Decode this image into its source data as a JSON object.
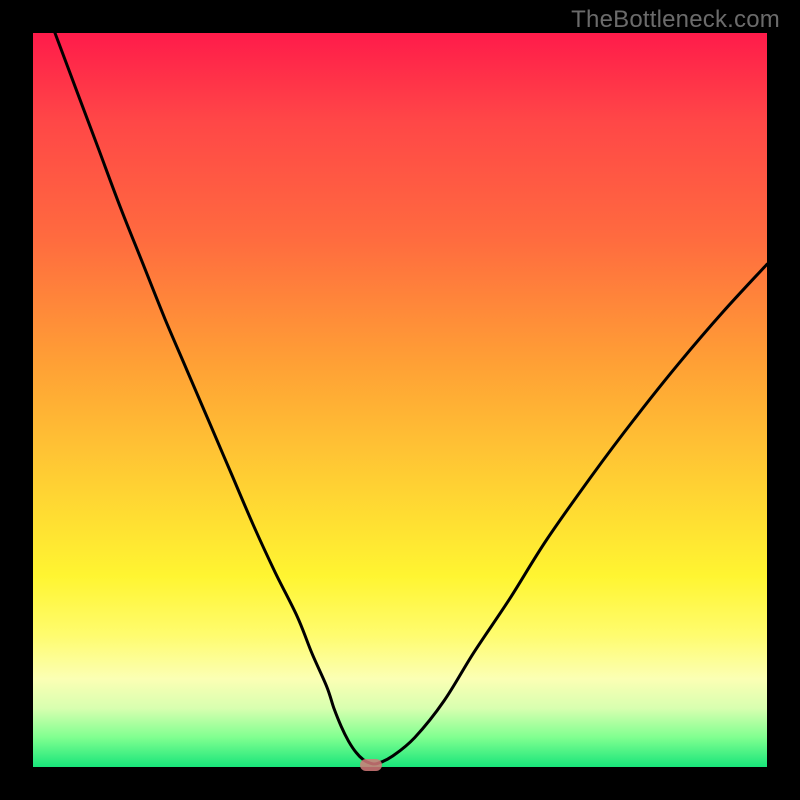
{
  "watermark": "TheBottleneck.com",
  "colors": {
    "frame": "#000000",
    "curve": "#000000",
    "marker": "#d47a7a",
    "gradient_stops": [
      "#ff1b4a",
      "#ff4747",
      "#ff6b3f",
      "#ffa035",
      "#ffd233",
      "#fff531",
      "#fffc6e",
      "#fbffb4",
      "#d8ffb0",
      "#7fff90",
      "#18e57a"
    ]
  },
  "chart_data": {
    "type": "line",
    "title": "",
    "xlabel": "",
    "ylabel": "",
    "xlim": [
      0,
      100
    ],
    "ylim": [
      0,
      100
    ],
    "grid": false,
    "legend": false,
    "x": [
      3,
      6,
      9,
      12,
      15,
      18,
      21,
      24,
      27,
      30,
      33,
      36,
      38,
      40,
      41,
      42,
      43,
      44,
      45,
      46,
      47,
      49,
      52,
      56,
      60,
      65,
      70,
      76,
      82,
      88,
      94,
      100
    ],
    "values": [
      100,
      92,
      84,
      76,
      68.5,
      61,
      54,
      47,
      40,
      33,
      26.5,
      20.5,
      15.5,
      11,
      8,
      5.5,
      3.5,
      2,
      1,
      0.5,
      0.5,
      1.5,
      4,
      9,
      15.5,
      23,
      31,
      39.5,
      47.5,
      55,
      62,
      68.5
    ],
    "marker": {
      "x": 46,
      "y": 0
    },
    "notes": "Single V-shaped curve reaching a minimum near x≈46 at the bottom of the plot; background gradient encodes value from red (high) to green (low). Values estimated from pixel positions; axes have no visible tick labels."
  }
}
